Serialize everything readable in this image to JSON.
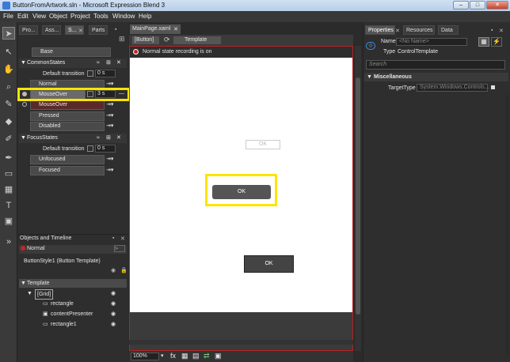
{
  "window": {
    "title": "ButtonFromArtwork.sln - Microsoft Expression Blend 3",
    "min": "–",
    "max": "□",
    "close": "✕"
  },
  "menu": [
    "File",
    "Edit",
    "View",
    "Object",
    "Project",
    "Tools",
    "Window",
    "Help"
  ],
  "left_tabs": [
    "Pro...",
    "Ass...",
    "S...",
    "Parts"
  ],
  "states": {
    "base": "Base",
    "group1": "CommonStates",
    "default_transition_label": "Default transition",
    "default_transition_value": "0 s",
    "items1": [
      "Normal",
      "MouseOver",
      "MouseOver",
      "Pressed",
      "Disabled"
    ],
    "mouseover_duration": "3 s",
    "group2": "FocusStates",
    "default_transition_value2": "0 s",
    "items2": [
      "Unfocused",
      "Focused"
    ]
  },
  "objects": {
    "panel_title": "Objects and Timeline",
    "state": "Normal",
    "style_name": "ButtonStyle1 (Button Template)",
    "tree": [
      "Template",
      "[Grid]",
      "rectangle",
      "contentPresenter",
      "rectangle1"
    ]
  },
  "document": {
    "tab": "MainPage.xaml",
    "breadcrumb_button": "[Button]",
    "breadcrumb_template": "Template",
    "recording_text": "Normal state recording is on",
    "ok_labels": [
      "OK",
      "OK",
      "OK"
    ],
    "zoom": "100%"
  },
  "properties": {
    "tabs": [
      "Properties",
      "Resources",
      "Data"
    ],
    "name_label": "Name",
    "name_placeholder": "<No Name>",
    "type_label": "Type",
    "type_value": "ControlTemplate",
    "search_placeholder": "Search",
    "section": "Miscellaneous",
    "targettype_label": "TargetType",
    "targettype_value": "System.Windows.Controls..."
  },
  "colors": {
    "highlight": "#ffe400",
    "recording": "#cc2222"
  }
}
